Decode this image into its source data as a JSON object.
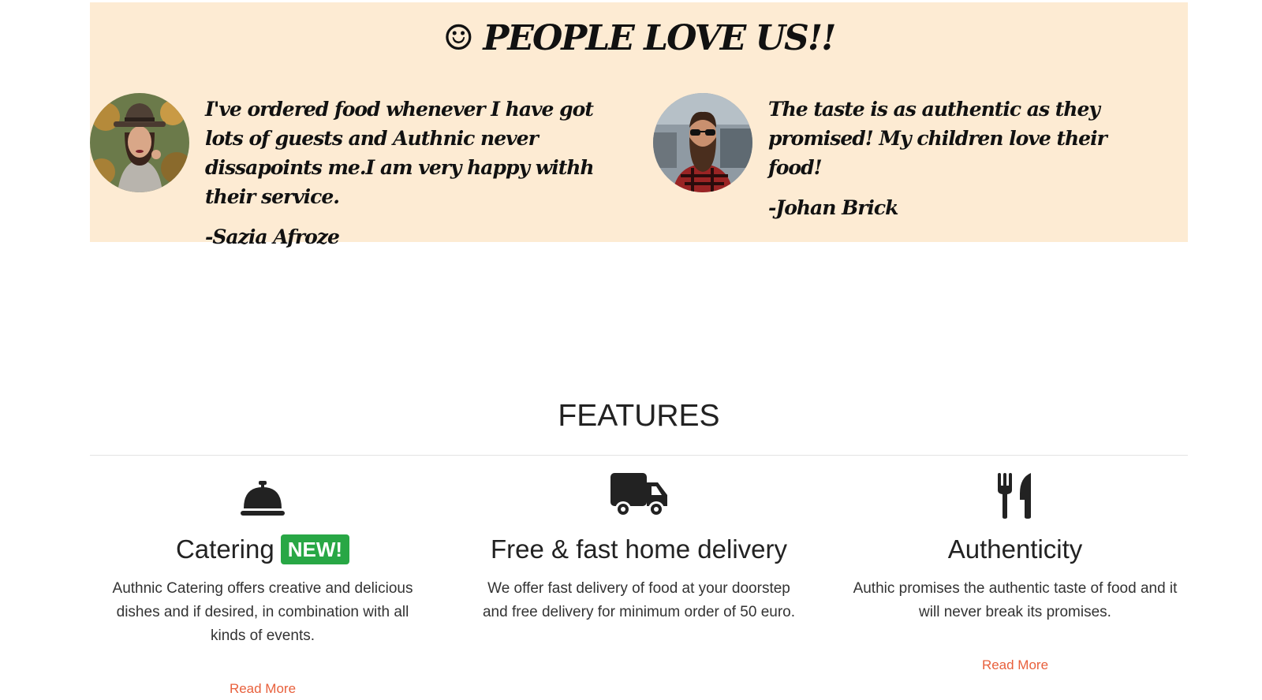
{
  "testimonials": {
    "title": "☺ PEOPLE LOVE US!!",
    "items": [
      {
        "quote": "I've ordered food whenever I have got lots of guests and Authnic never dissapoints me.I am very happy withh their service.",
        "author": "-Sazia Afroze",
        "avatar": "woman-in-hat-avatar"
      },
      {
        "quote": "The taste is as authentic as they promised! My children love their food!",
        "author": "-Johan Brick",
        "avatar": "bearded-man-avatar"
      }
    ]
  },
  "features": {
    "title": "FEATURES",
    "items": [
      {
        "icon": "concierge-bell-icon",
        "title": "Catering",
        "badge": "NEW!",
        "text": "Authnic Catering offers creative and delicious dishes and if desired, in combination with all kinds of events.",
        "link": "Read More"
      },
      {
        "icon": "truck-icon",
        "title": "Free & fast home delivery",
        "text": "We offer fast delivery of food at your doorstep and free delivery for minimum order of 50 euro."
      },
      {
        "icon": "utensils-icon",
        "title": "Authenticity",
        "text": "Authic promises the authentic taste of food and it will never break its promises.",
        "link": "Read More"
      }
    ]
  },
  "colors": {
    "testimonial_bg": "#fdebd3",
    "badge_bg": "#28a745",
    "link": "#e8603c"
  }
}
